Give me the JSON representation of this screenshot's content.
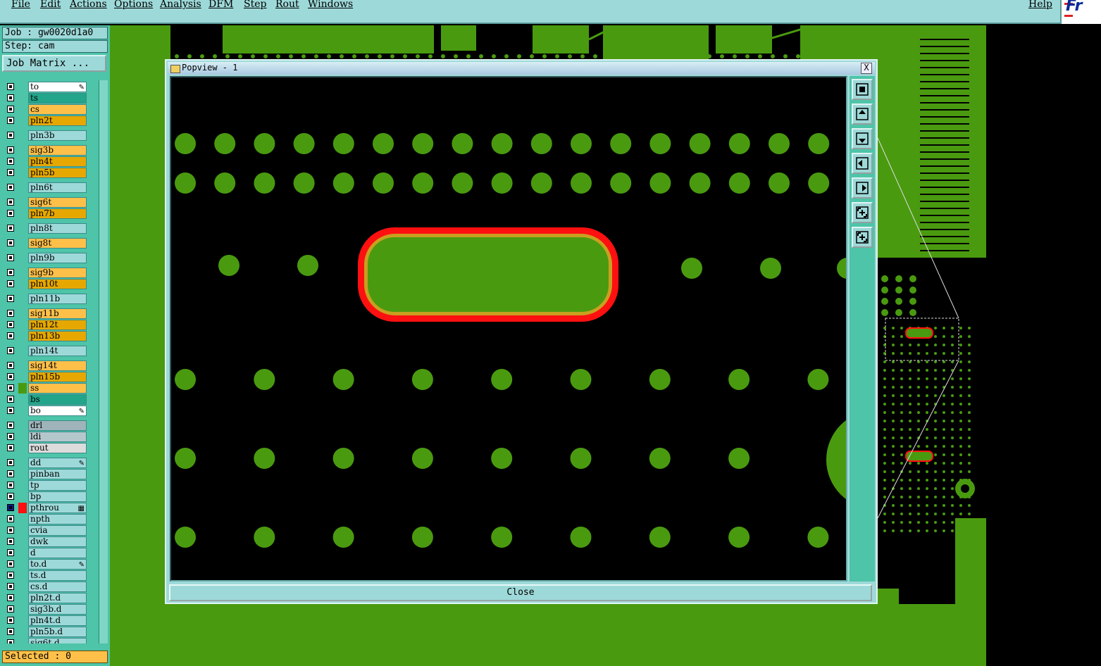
{
  "menu": {
    "items": [
      "File",
      "Edit",
      "Actions",
      "Options",
      "Analysis",
      "DFM",
      "Step",
      "Rout",
      "Windows"
    ],
    "help": "Help"
  },
  "brand": {
    "text": "Fr"
  },
  "job": {
    "label": "Job : gw0020d1a0",
    "step": "Step: cam"
  },
  "job_matrix_button": "Job Matrix ...",
  "layers": [
    {
      "name": "to",
      "color": "#ffffff",
      "mark": "pen"
    },
    {
      "name": "ts",
      "color": "#22a58a"
    },
    {
      "name": "cs",
      "color": "#ffc04a"
    },
    {
      "name": "pln2t",
      "color": "#e6a800"
    },
    {
      "name": "pln3b",
      "color": "#9ed9d9",
      "gap": true
    },
    {
      "name": "sig3b",
      "color": "#ffc04a",
      "gap": true
    },
    {
      "name": "pln4t",
      "color": "#e6a800"
    },
    {
      "name": "pln5b",
      "color": "#e6a800"
    },
    {
      "name": "pln6t",
      "color": "#9ed9d9",
      "gap": true
    },
    {
      "name": "sig6t",
      "color": "#ffc04a",
      "gap": true
    },
    {
      "name": "pln7b",
      "color": "#e6a800"
    },
    {
      "name": "pln8t",
      "color": "#9ed9d9",
      "gap": true
    },
    {
      "name": "sig8t",
      "color": "#ffc04a",
      "gap": true
    },
    {
      "name": "pln9b",
      "color": "#9ed9d9",
      "gap": true
    },
    {
      "name": "sig9b",
      "color": "#ffc04a",
      "gap": true
    },
    {
      "name": "pln10t",
      "color": "#e6a800"
    },
    {
      "name": "pln11b",
      "color": "#9ed9d9",
      "gap": true
    },
    {
      "name": "sig11b",
      "color": "#ffc04a",
      "gap": true
    },
    {
      "name": "pln12t",
      "color": "#e6a800"
    },
    {
      "name": "pln13b",
      "color": "#e6a800"
    },
    {
      "name": "pln14t",
      "color": "#9ed9d9",
      "gap": true
    },
    {
      "name": "sig14t",
      "color": "#ffc04a",
      "gap": true
    },
    {
      "name": "pln15b",
      "color": "#e6a800"
    },
    {
      "name": "ss",
      "color": "#ffc04a",
      "swatch": "#4a9a10"
    },
    {
      "name": "bs",
      "color": "#22a58a"
    },
    {
      "name": "bo",
      "color": "#ffffff",
      "mark": "pen"
    },
    {
      "name": "drl",
      "color": "#9fb4ba",
      "gap": true
    },
    {
      "name": "ldi",
      "color": "#b4c8cc"
    },
    {
      "name": "rout",
      "color": "#dcdcdc"
    },
    {
      "name": "dd",
      "color": "#9ed9d9",
      "gap": true,
      "mark": "pen"
    },
    {
      "name": "pinban",
      "color": "#9ed9d9"
    },
    {
      "name": "tp",
      "color": "#9ed9d9"
    },
    {
      "name": "bp",
      "color": "#9ed9d9"
    },
    {
      "name": "pthrou",
      "color": "#9ed9d9",
      "swatch": "#ff1010",
      "active": true,
      "mark": "grid"
    },
    {
      "name": "npth",
      "color": "#9ed9d9"
    },
    {
      "name": "cvia",
      "color": "#9ed9d9"
    },
    {
      "name": "dwk",
      "color": "#9ed9d9"
    },
    {
      "name": "d",
      "color": "#9ed9d9"
    },
    {
      "name": "to.d",
      "color": "#9ed9d9",
      "mark": "pen"
    },
    {
      "name": "ts.d",
      "color": "#9ed9d9"
    },
    {
      "name": "cs.d",
      "color": "#9ed9d9"
    },
    {
      "name": "pln2t.d",
      "color": "#9ed9d9"
    },
    {
      "name": "sig3b.d",
      "color": "#9ed9d9"
    },
    {
      "name": "pln4t.d",
      "color": "#9ed9d9"
    },
    {
      "name": "pln5b.d",
      "color": "#9ed9d9"
    },
    {
      "name": "sig6t.d",
      "color": "#9ed9d9"
    }
  ],
  "selected": "Selected : 0",
  "popview": {
    "title": "Popview - 1",
    "close_x": "X",
    "close_button": "Close",
    "tool_icons": [
      "zoom-fit-icon",
      "pan-up-icon",
      "pan-down-icon",
      "pan-left-icon",
      "pan-right-icon",
      "zoom-out-icon",
      "zoom-in-icon"
    ]
  },
  "colors": {
    "pad": "#4a9a10",
    "highlight": "#ff1010",
    "highlight_inner": "#c8a020",
    "panel": "#4ec4a8",
    "frame": "#9ed9d9"
  }
}
